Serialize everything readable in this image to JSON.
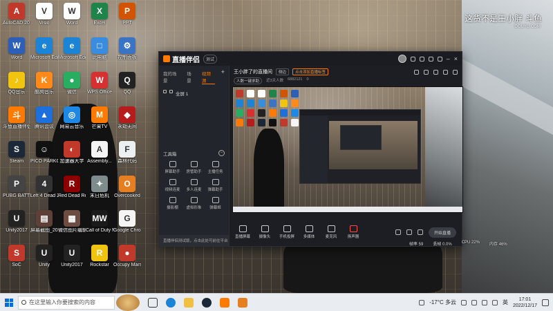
{
  "watermark": {
    "text": "这货不是王小胖",
    "brand": "斗鱼",
    "brand_sub": "DOUYU.COM"
  },
  "desktop_icons": [
    {
      "label": "AutoCAD 2015",
      "color": "#c0392b",
      "glyph": "A"
    },
    {
      "label": "Visio",
      "color": "#ffffff",
      "glyph": "V"
    },
    {
      "label": "Word",
      "color": "#ffffff",
      "glyph": "W"
    },
    {
      "label": "Excel",
      "color": "#1e8449",
      "glyph": "X"
    },
    {
      "label": "PPT",
      "color": "#d35400",
      "glyph": "P"
    },
    {
      "label": "Word",
      "color": "#2e5fb8",
      "glyph": "W"
    },
    {
      "label": "Microsoft Edge",
      "color": "#1b84d6",
      "glyph": "e"
    },
    {
      "label": "Microsoft Edge",
      "color": "#1b84d6",
      "glyph": "e"
    },
    {
      "label": "此电脑",
      "color": "#3a8dde",
      "glyph": "□"
    },
    {
      "label": "控制面板",
      "color": "#3b74c5",
      "glyph": "⚙"
    },
    {
      "label": "QQ音乐",
      "color": "#f1c40f",
      "glyph": "♪"
    },
    {
      "label": "酷狗音乐",
      "color": "#ff8a1a",
      "glyph": "K"
    },
    {
      "label": "微信",
      "color": "#27ae60",
      "glyph": "●"
    },
    {
      "label": "WPS Office",
      "color": "#d63031",
      "glyph": "W"
    },
    {
      "label": "QQ",
      "color": "#222222",
      "glyph": "Q"
    },
    {
      "label": "斗鱼直播伴侣",
      "color": "#ff7a00",
      "glyph": "斗"
    },
    {
      "label": "腾讯会议",
      "color": "#1d6fdb",
      "glyph": "▲"
    },
    {
      "label": "网易云音乐",
      "color": "#1e88e5",
      "glyph": "◎"
    },
    {
      "label": "芒果TV",
      "color": "#ff7a00",
      "glyph": "M"
    },
    {
      "label": "永劫无间",
      "color": "#b71c1c",
      "glyph": "◆"
    },
    {
      "label": "Steam",
      "color": "#1b2838",
      "glyph": "S"
    },
    {
      "label": "PICO PARKClas...",
      "color": "#111111",
      "glyph": "☺"
    },
    {
      "label": "加速器大学",
      "color": "#c0392b",
      "glyph": "◐"
    },
    {
      "label": "Assembly...",
      "color": "#f5f5f5",
      "glyph": "A"
    },
    {
      "label": "森林代码",
      "color": "#ecf0f1",
      "glyph": "F"
    },
    {
      "label": "PUBG BATTLEGR...",
      "color": "#444444",
      "glyph": "P"
    },
    {
      "label": "Left 4 Dead 2",
      "color": "#333333",
      "glyph": "4"
    },
    {
      "label": "Red Dead Redemption",
      "color": "#8e0000",
      "glyph": "R"
    },
    {
      "label": "末日危机",
      "color": "#7f8c8d",
      "glyph": "✦"
    },
    {
      "label": "Overcooked",
      "color": "#e67e22",
      "glyph": "O"
    },
    {
      "label": "Unity2017",
      "color": "#222222",
      "glyph": "U"
    },
    {
      "label": "屏幕截图_2022120...",
      "color": "#5d4037",
      "glyph": "▤"
    },
    {
      "label": "微信图片编辑_2022120...",
      "color": "#6d4c41",
      "glyph": "▦"
    },
    {
      "label": "Call of Duty MW",
      "color": "#1a1a1a",
      "glyph": "MW"
    },
    {
      "label": "Google Chrome",
      "color": "#f5f5f5",
      "glyph": "G"
    },
    {
      "label": "SoC",
      "color": "#c0392b",
      "glyph": "S"
    },
    {
      "label": "Unity",
      "color": "#222222",
      "glyph": "U"
    },
    {
      "label": "Unity2017",
      "color": "#222222",
      "glyph": "U"
    },
    {
      "label": "Rockstar",
      "color": "#f1c40f",
      "glyph": "R"
    },
    {
      "label": "Occupy Mars",
      "color": "#c0392b",
      "glyph": "●"
    }
  ],
  "app": {
    "name": "直播伴侣",
    "version_badge": "测试",
    "sidebar_tabs": [
      "我的场景",
      "场景",
      "视频源"
    ],
    "scene_label": "全屏 1",
    "tools_title": "工具箱",
    "tools": [
      "屏幕助手",
      "房管助手",
      "主播任务",
      "视频连麦",
      "多人连麦",
      "弹幕助手",
      "摄影棚",
      "虚拟形象",
      "弹幕姬"
    ],
    "bottom_notice": "直播伴侣测试版，点击此处可前往平台",
    "room_title": "王小胖了的直播间",
    "tags": [
      "侧边",
      "点击添加直播标签"
    ],
    "meta": [
      "人数一键求助",
      "近3天人数",
      "6882121",
      "0"
    ],
    "controls": [
      "直播屏幕",
      "摄像头",
      "手机投屏",
      "多媒体",
      "麦克风",
      "扬声器"
    ],
    "start_label": "开始直播"
  },
  "stats": [
    "帧率 59",
    "丢帧 0.0%",
    "CPU 22%",
    "内存 46%"
  ],
  "taskbar": {
    "search_placeholder": "在这里输入你要搜索的内容",
    "weather": "-17°C 多云",
    "ime": "英",
    "time": "17:01",
    "date": "2022/12/17"
  }
}
